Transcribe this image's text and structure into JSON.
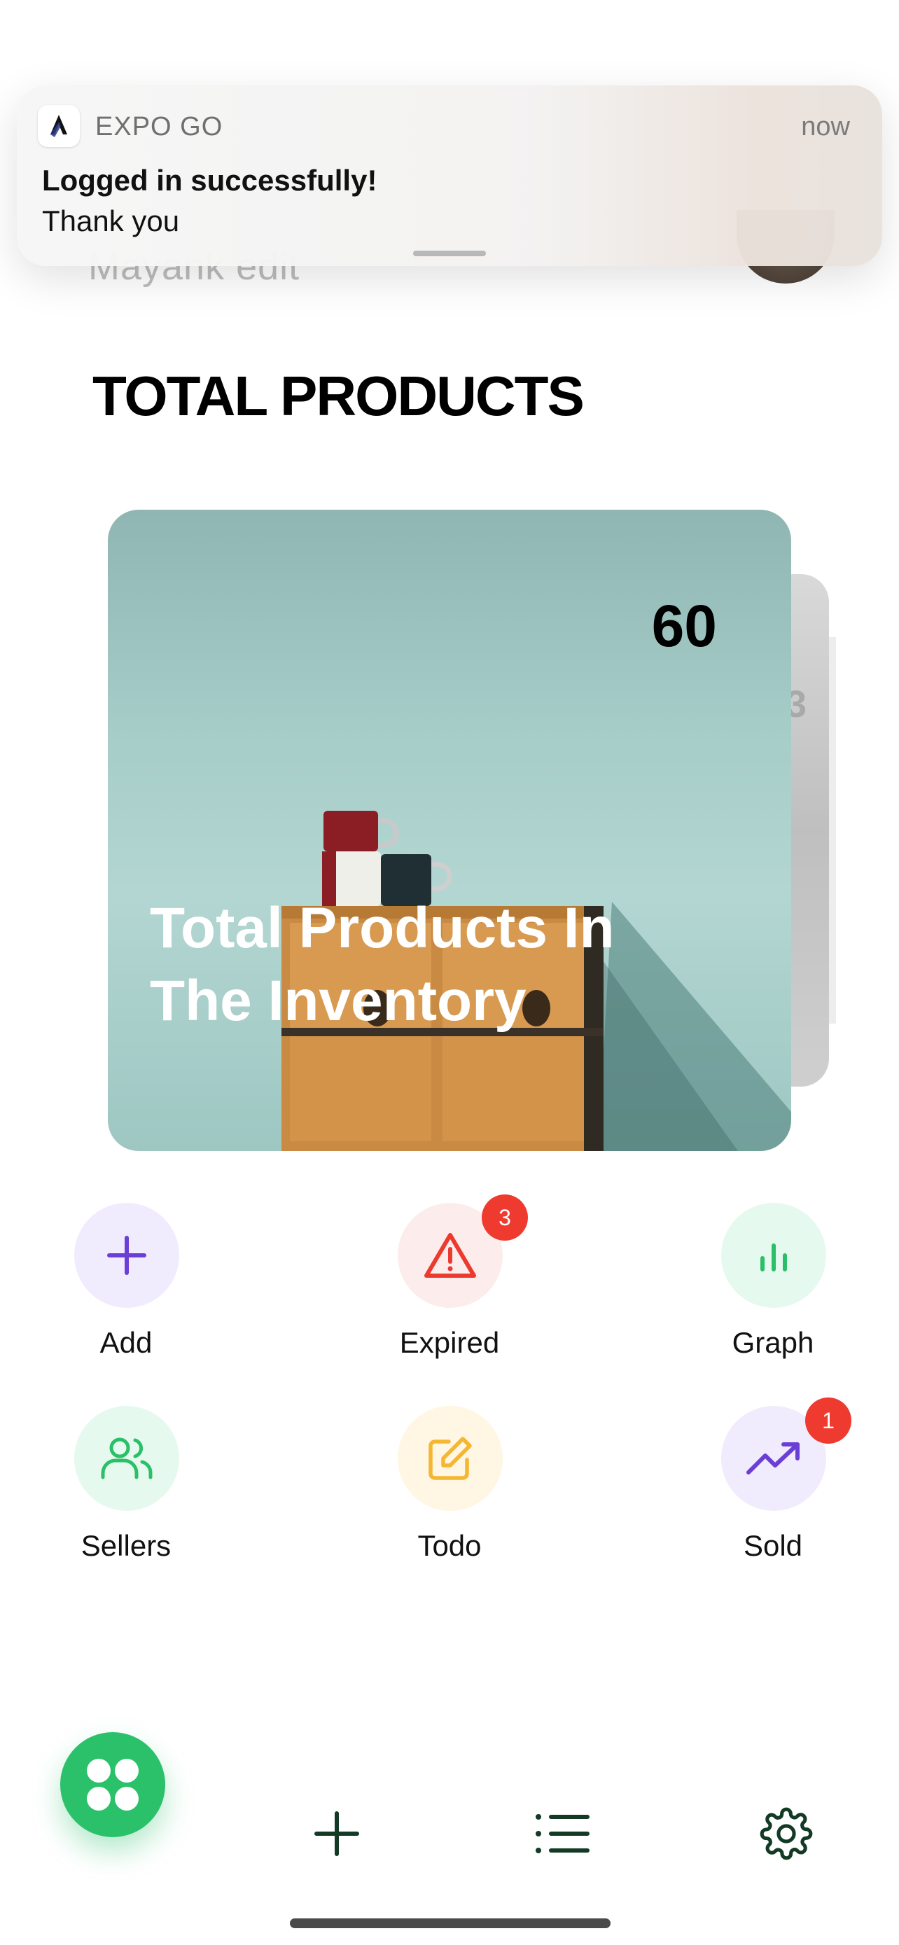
{
  "notification": {
    "app_name": "EXPO GO",
    "time": "now",
    "title": "Logged in successfully!",
    "body": "Thank you"
  },
  "header": {
    "greeting": "Mayank edit",
    "avatar_icon": "avatar"
  },
  "main": {
    "title": "TOTAL PRODUCTS",
    "cards": [
      {
        "count": "60",
        "caption": "Total Products In The Inventory"
      },
      {
        "count": "3"
      }
    ]
  },
  "actions": [
    {
      "label": "Add",
      "icon": "plus-icon",
      "color": "#6b3fd6",
      "bg": "#f1ecfd"
    },
    {
      "label": "Expired",
      "icon": "alert-triangle-icon",
      "color": "#ec3a2e",
      "bg": "#fdecec",
      "badge": "3"
    },
    {
      "label": "Graph",
      "icon": "bar-chart-icon",
      "color": "#2bbf6a",
      "bg": "#e6f9ee"
    },
    {
      "label": "Sellers",
      "icon": "users-icon",
      "color": "#2bbf6a",
      "bg": "#e6f9ee"
    },
    {
      "label": "Todo",
      "icon": "edit-icon",
      "color": "#f5b731",
      "bg": "#fff6e3"
    },
    {
      "label": "Sold",
      "icon": "trending-up-icon",
      "color": "#6b3fd6",
      "bg": "#f1ecfd",
      "badge": "1"
    }
  ],
  "bottom_nav": {
    "fab_icon": "grid-dots-icon",
    "fab_color": "#2bc16a",
    "items": [
      "plus-icon",
      "list-icon",
      "settings-icon"
    ],
    "icon_color": "#123a24"
  }
}
